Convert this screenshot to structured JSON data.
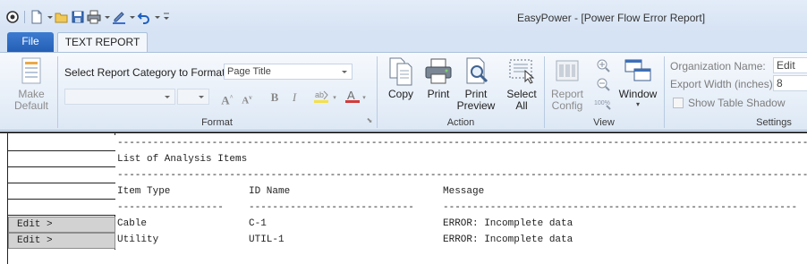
{
  "window": {
    "app_title": "EasyPower - [Power Flow Error Report]"
  },
  "quick_access": [
    "app-icon",
    "new-icon",
    "open-icon",
    "save-icon",
    "print-icon",
    "pen-icon",
    "undo-icon",
    "customize-icon"
  ],
  "tabs": {
    "file": "File",
    "text_report": "TEXT REPORT"
  },
  "ribbon": {
    "make_default": {
      "line1": "Make",
      "line2": "Default"
    },
    "format": {
      "category_label": "Select Report Category to Format:",
      "category_value": "Page Title",
      "font_name": "",
      "font_size": "",
      "group_label": "Format"
    },
    "action": {
      "copy": "Copy",
      "print": "Print",
      "print_preview": {
        "line1": "Print",
        "line2": "Preview"
      },
      "select_all": {
        "line1": "Select",
        "line2": "All"
      },
      "group_label": "Action"
    },
    "view": {
      "report_config": {
        "line1": "Report",
        "line2": "Config"
      },
      "window": "Window",
      "group_label": "View"
    },
    "settings": {
      "org_name_label": "Organization Name:",
      "org_name_value": "Edit",
      "export_width_label": "Export Width (inches):",
      "export_width_value": "8",
      "table_shadow_label": "Show Table Shadow",
      "group_label": "Settings"
    }
  },
  "report": {
    "row_headers": [
      "",
      "",
      "",
      "",
      "",
      "Edit >",
      "Edit >",
      ""
    ],
    "lines": {
      "rule1": "-------------------------------------------------------------------------------------------------------------------------",
      "title": "List of Analysis Items",
      "rule2": "-------------------------------------------------------------------------------------------------------------------------",
      "headers": [
        "Item Type",
        "ID Name",
        "Message"
      ],
      "header_rules": [
        "------------------",
        "----------------------------",
        "------------------------------------------------------------"
      ]
    },
    "rows": [
      {
        "type": "Cable",
        "id": "C-1",
        "message": "ERROR: Incomplete data"
      },
      {
        "type": "Utility",
        "id": "UTIL-1",
        "message": "ERROR: Incomplete data"
      }
    ]
  },
  "colors": {
    "file_tab": "#245fb5",
    "ribbon_bg": "#e6eef8",
    "edit_header": "#d2d2d2"
  }
}
